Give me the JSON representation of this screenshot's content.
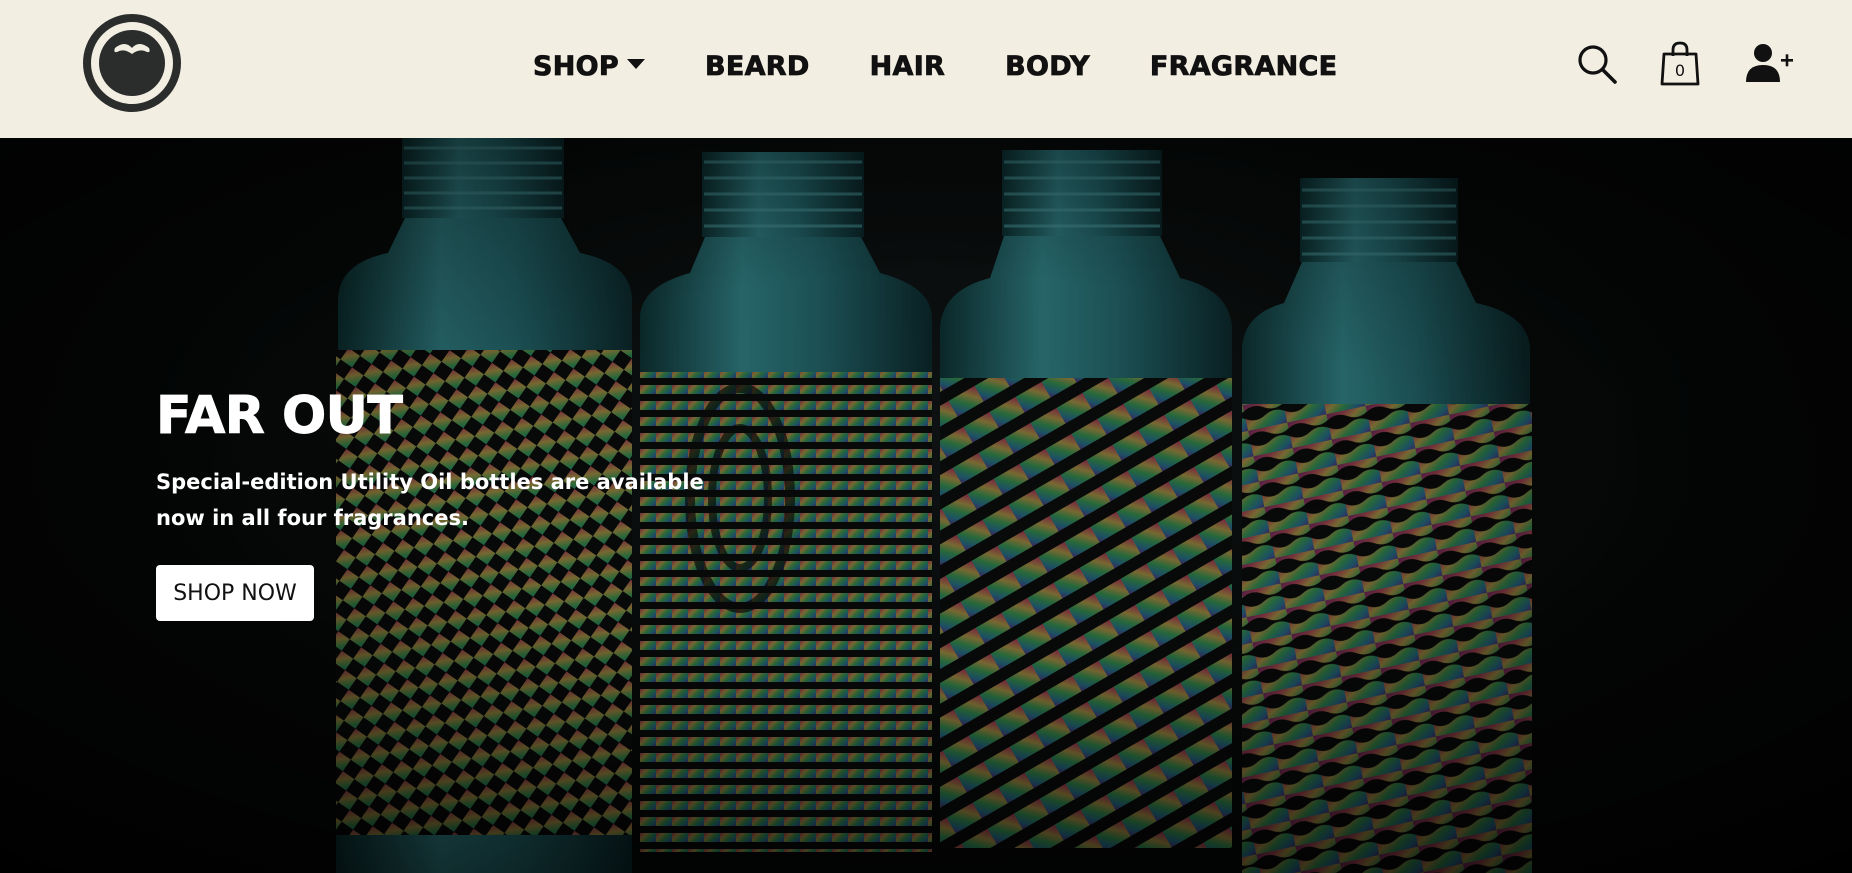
{
  "header": {
    "logo_icon": "beard-logo-icon",
    "nav": {
      "shop": "SHOP",
      "beard": "BEARD",
      "hair": "HAIR",
      "body": "BODY",
      "fragrance": "FRAGRANCE"
    },
    "icons": {
      "search": "search-icon",
      "bag": "shopping-bag-icon",
      "account": "add-user-icon"
    },
    "bag_count": "0"
  },
  "hero": {
    "title": "FAR OUT",
    "subtitle": "Special-edition Utility Oil bottles are available now in all four fragrances.",
    "cta_label": "SHOP NOW"
  },
  "colors": {
    "header_bg": "#f3eee2",
    "logo": "#2b2d2d",
    "bottle_metal": "#2e8c92",
    "hero_bg": "#070909",
    "button_bg": "#ffffff"
  }
}
